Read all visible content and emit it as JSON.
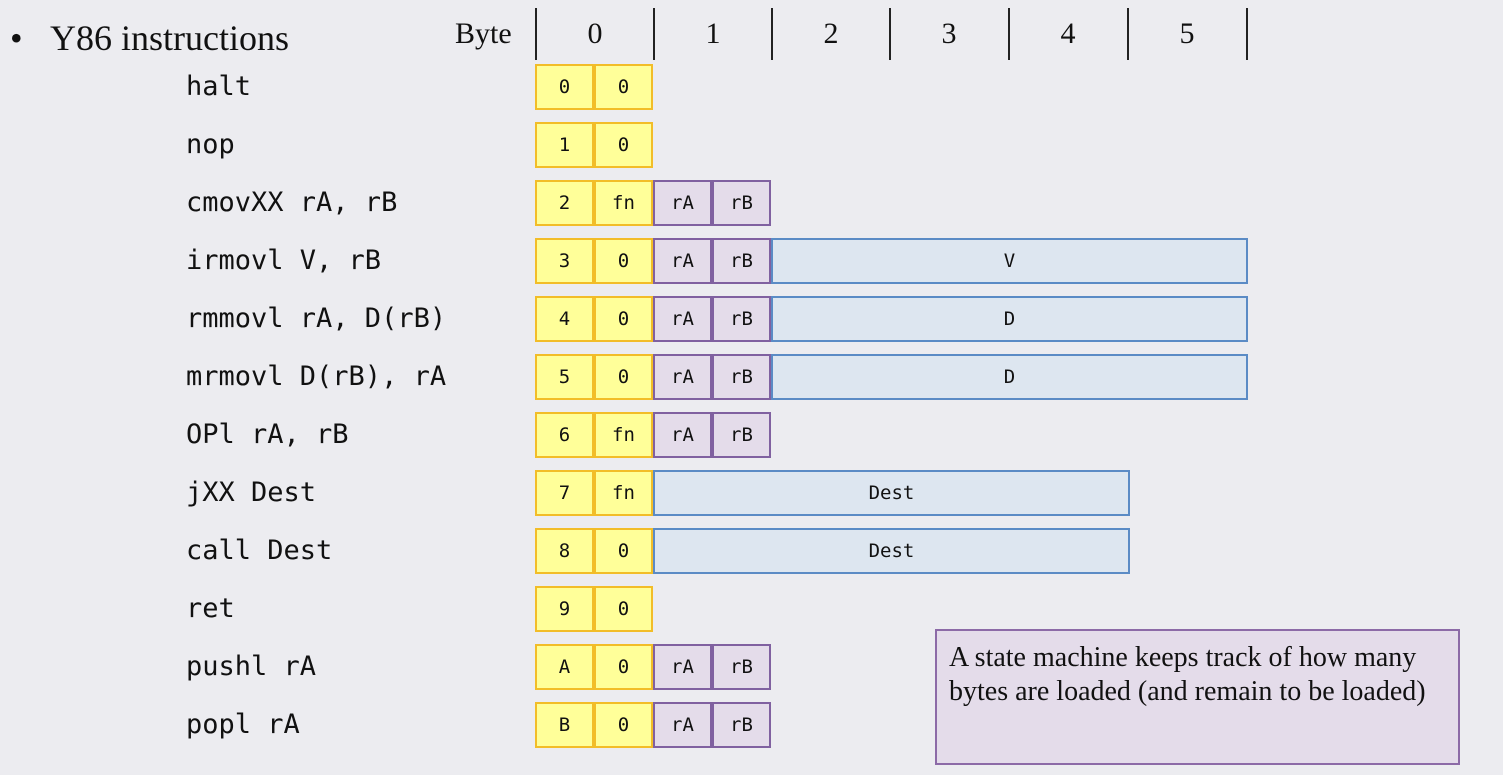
{
  "bullet": {
    "symbol": "•",
    "text": "Y86 instructions"
  },
  "header": {
    "byte_label": "Byte",
    "columns": [
      "0",
      "1",
      "2",
      "3",
      "4",
      "5"
    ]
  },
  "instructions": [
    {
      "mnemonic": "halt",
      "code": "0",
      "fn": "0"
    },
    {
      "mnemonic": "nop",
      "code": "1",
      "fn": "0"
    },
    {
      "mnemonic": "cmovXX rA, rB",
      "code": "2",
      "fn": "fn",
      "ra": "rA",
      "rb": "rB"
    },
    {
      "mnemonic": "irmovl V, rB",
      "code": "3",
      "fn": "0",
      "ra": "rA",
      "rb": "rB",
      "value": "V"
    },
    {
      "mnemonic": "rmmovl rA, D(rB)",
      "code": "4",
      "fn": "0",
      "ra": "rA",
      "rb": "rB",
      "value": "D"
    },
    {
      "mnemonic": "mrmovl D(rB), rA",
      "code": "5",
      "fn": "0",
      "ra": "rA",
      "rb": "rB",
      "value": "D"
    },
    {
      "mnemonic": "OPl rA, rB",
      "code": "6",
      "fn": "fn",
      "ra": "rA",
      "rb": "rB"
    },
    {
      "mnemonic": "jXX Dest",
      "code": "7",
      "fn": "fn",
      "dest": "Dest"
    },
    {
      "mnemonic": "call Dest",
      "code": "8",
      "fn": "0",
      "dest": "Dest"
    },
    {
      "mnemonic": "ret",
      "code": "9",
      "fn": "0"
    },
    {
      "mnemonic": "pushl rA",
      "code": "A",
      "fn": "0",
      "ra": "rA",
      "rb": "rB"
    },
    {
      "mnemonic": "popl rA",
      "code": "B",
      "fn": "0",
      "ra": "rA",
      "rb": "rB"
    }
  ],
  "note": "A state machine keeps track of how many bytes are loaded (and remain to be loaded)"
}
